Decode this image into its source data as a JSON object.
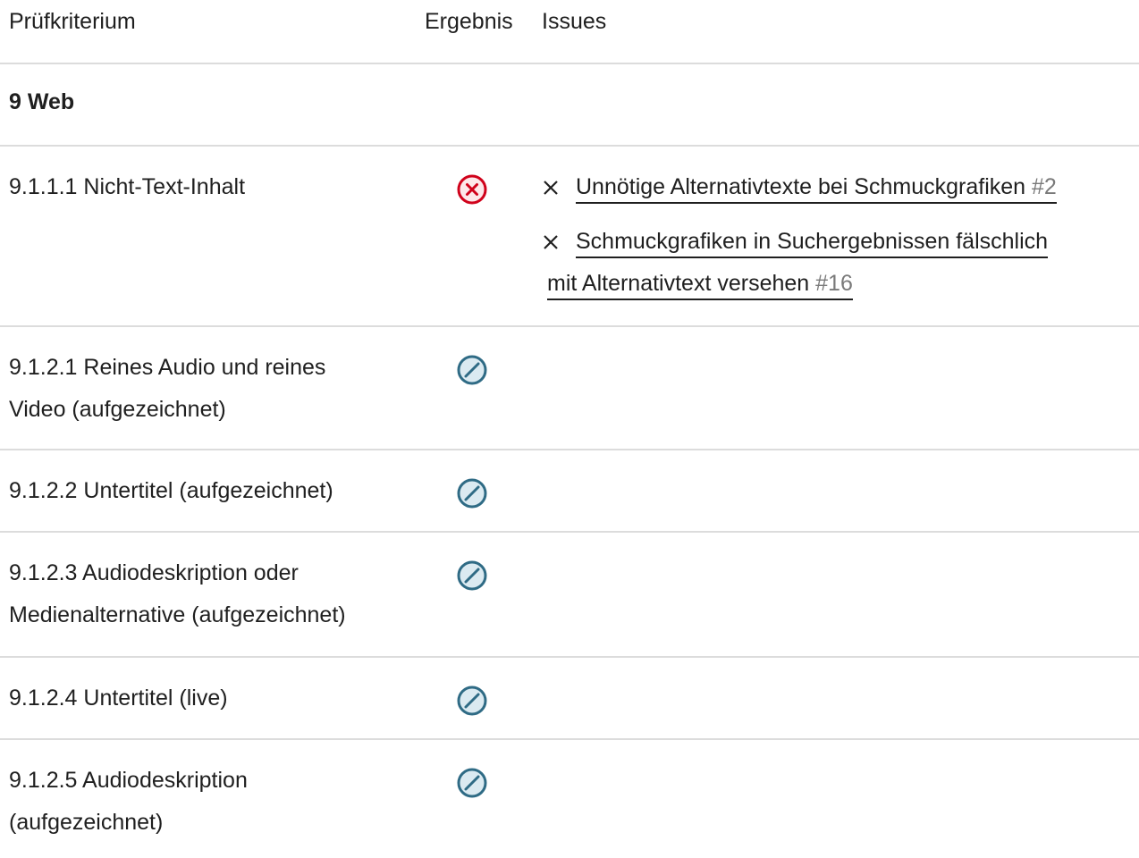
{
  "table": {
    "headers": {
      "criterion": "Prüfkriterium",
      "result": "Ergebnis",
      "issues": "Issues"
    },
    "group": "9 Web",
    "rows": [
      {
        "criterion": "9.1.1.1 Nicht-Text-Inhalt",
        "result_icon": "fail-icon",
        "issues": [
          {
            "text": "Unnötige Alternativtexte bei Schmuckgrafiken",
            "number": "#2"
          },
          {
            "text_line1": "Schmuckgrafiken in Suchergebnissen fälschlich",
            "text_line2": "mit Alternativtext versehen",
            "number": "#16"
          }
        ]
      },
      {
        "criterion_line1": "9.1.2.1 Reines Audio und reines",
        "criterion_line2": "Video (aufgezeichnet)",
        "result_icon": "not-applicable-icon"
      },
      {
        "criterion": "9.1.2.2 Untertitel (aufgezeichnet)",
        "result_icon": "not-applicable-icon"
      },
      {
        "criterion_line1": "9.1.2.3 Audiodeskription oder",
        "criterion_line2": "Medienalternative (aufgezeichnet)",
        "result_icon": "not-applicable-icon"
      },
      {
        "criterion": "9.1.2.4 Untertitel (live)",
        "result_icon": "not-applicable-icon"
      },
      {
        "criterion_line1": "9.1.2.5 Audiodeskription",
        "criterion_line2": "(aufgezeichnet)",
        "result_icon": "not-applicable-icon"
      }
    ]
  },
  "colors": {
    "fail": "#d0021b",
    "fail_bg": "#fde8ea",
    "not_applicable": "#2f6b85",
    "not_applicable_bg": "#dbeaf1",
    "divider": "#dcdcdc",
    "issue_number": "#7a7a7a"
  }
}
